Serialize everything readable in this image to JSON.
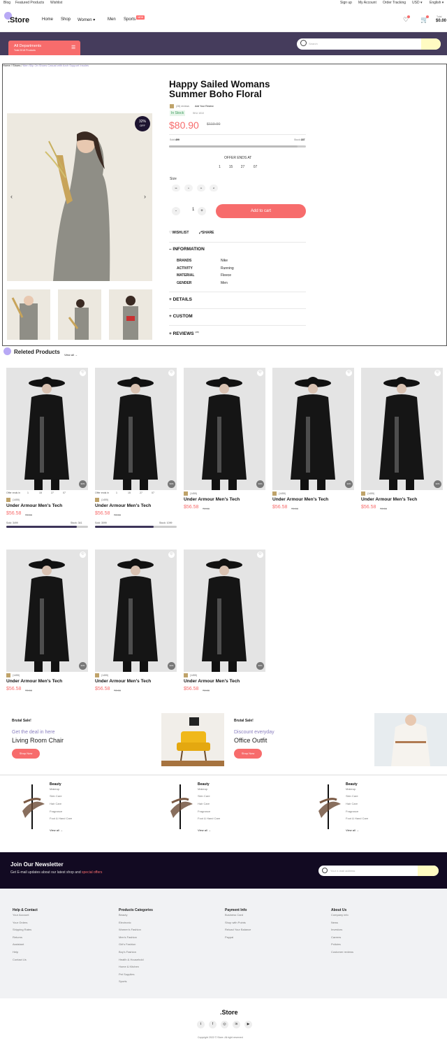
{
  "topbar": {
    "links": [
      "Blog",
      "Featured Products",
      "Wishlist"
    ],
    "right": [
      "Sign up",
      "My Account",
      "Order Tracking",
      "USD",
      "English"
    ]
  },
  "header": {
    "logo": ".Store",
    "nav": [
      "Home",
      "Shop",
      "Women",
      "Men",
      "Sports"
    ],
    "hot": "NEW",
    "cart_label": "Total",
    "cart_total": "$0.00"
  },
  "departments": {
    "title": "All Departments",
    "subtitle": "Total 2018 Products"
  },
  "search": {
    "placeholder": "Search"
  },
  "breadcrumb": {
    "home": "Home",
    "sep1": "/",
    "shoes": "Shoes",
    "sep2": "/",
    "current": "Men Slip On Shoes Casual with Arch Support Insoles"
  },
  "product": {
    "title": "Happy Sailed Womans Summer Boho Floral",
    "reviews": "(28) reviews",
    "add_review": "Add Your Review",
    "stock": "In Stock",
    "sku": "SKU 1010",
    "price": "$80.90",
    "old_price": "$119.90",
    "badge_pct": "32%",
    "badge_off": "OFF",
    "sold_label": "Sold:",
    "sold": "499",
    "stock_label": "Stock:",
    "stock_val": "187",
    "offer_ends": "OFFER ENDS AT",
    "countdown": [
      "1",
      "15",
      "27",
      "07"
    ],
    "size_label": "Size",
    "sizes": [
      "xs",
      "s",
      "m",
      "xl"
    ],
    "qty": "1",
    "minus": "-",
    "plus": "+",
    "add_to_cart": "Add to cart",
    "wishlist": "WISHLIST",
    "share": "SHARE",
    "info_title": "INFORMATION",
    "info": [
      {
        "k": "BRANDS",
        "v": "Nike"
      },
      {
        "k": "ACTIVITY",
        "v": "Running"
      },
      {
        "k": "MATERIAL",
        "v": "Fleece"
      },
      {
        "k": "GENDER",
        "v": "Men"
      }
    ],
    "details": "DETAILS",
    "custom": "CUSTOM",
    "reviews_title": "REVIEWS",
    "reviews_count": "(28)",
    "stock_fill": 0.94
  },
  "related": {
    "title": "Releted Products",
    "view_all": "View all",
    "product_name": "Under Armour Men's Tech",
    "price": "$56.58",
    "old_price": "78.66",
    "reviews": "(1455)",
    "discount": "30%",
    "offer_label": "Offer ends in",
    "countdown": [
      "1",
      "15",
      "27",
      "07"
    ],
    "card1_sold": "Sold: 3499",
    "card1_stock": "Stock: 341",
    "card1_fill": 0.86,
    "card2_sold": "Sold: 3099",
    "card2_stock": "Stock: 1099",
    "card2_fill": 0.72
  },
  "promos": [
    {
      "tag": "Brutal Sale!",
      "line1": "Get the deal in here",
      "line2": "Living Room Chair",
      "btn": "Shop Now"
    },
    {
      "tag": "Brutal Sale!",
      "line1": "Discount everyday",
      "line2": "Office Outfit",
      "btn": "Shop Now"
    }
  ],
  "categories": {
    "title": "Beauty",
    "items": [
      "Makeup",
      "Skin Care",
      "Hair Care",
      "Fragrance",
      "Foot & Hand Care"
    ],
    "view_all": "View all"
  },
  "newsletter": {
    "title": "Join Our Newsletter",
    "desc": "Get E-mail updates about our latest shop and",
    "highlight": "special offers",
    "placeholder": "Your e-mail address"
  },
  "footer": {
    "cols": [
      {
        "title": "Help & Contact",
        "items": [
          "Your Account",
          "Your Orders",
          "Shipping Rates",
          "Returns",
          "Assistant",
          "Help",
          "Contact Us"
        ]
      },
      {
        "title": "Products Categories",
        "items": [
          "Beauty",
          "Electronic",
          "Women's Fashion",
          "Men's Fashion",
          "Girl's Fashion",
          "Boy's Fashion",
          "Health & Household",
          "Home & Kitchen",
          "Pet Supplies",
          "Sports"
        ]
      },
      {
        "title": "Payment Info",
        "items": [
          "Business Card",
          "Shop with Points",
          "Reload Your Balance",
          "Paypal"
        ]
      },
      {
        "title": "About Us",
        "items": [
          "Company info",
          "News",
          "Investors",
          "Careers",
          "Policies",
          "Customer reviews"
        ]
      }
    ],
    "logo": ".Store",
    "copyright": "Copyright 2022 © Store. All right reserved"
  }
}
